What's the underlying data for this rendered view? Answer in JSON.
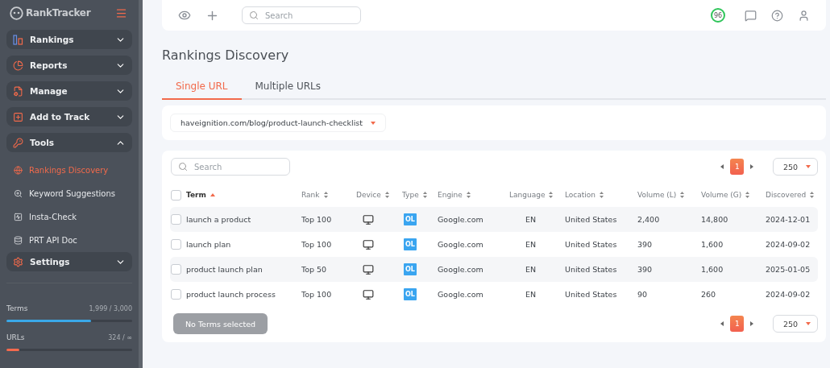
{
  "sidebar": {
    "logo": "RankTracker",
    "menu": [
      {
        "label": "Rankings",
        "kind": "rankings",
        "expanded": false
      },
      {
        "label": "Reports",
        "kind": "reports",
        "expanded": false
      },
      {
        "label": "Manage",
        "kind": "manage",
        "expanded": false
      },
      {
        "label": "Add to Track",
        "kind": "add",
        "expanded": false
      },
      {
        "label": "Tools",
        "kind": "tools",
        "expanded": true,
        "children": [
          {
            "label": "Rankings Discovery",
            "kind": "globe",
            "selected": true
          },
          {
            "label": "Keyword Suggestions",
            "kind": "suggest",
            "selected": false
          },
          {
            "label": "Insta-Check",
            "kind": "insta",
            "selected": false
          },
          {
            "label": "PRT API Doc",
            "kind": "api",
            "selected": false
          }
        ]
      },
      {
        "label": "Settings",
        "kind": "settings",
        "expanded": false
      }
    ],
    "usage": [
      {
        "label": "Terms",
        "reading": "1,999 / 3,000",
        "level": 0.67,
        "color": "#3aa8e8"
      },
      {
        "label": "URLs",
        "reading": "324 / ∞",
        "level": 0.1,
        "color": "#f46a4e"
      }
    ]
  },
  "topbar": {
    "search": {
      "placeholder": "Search"
    },
    "score": "96"
  },
  "page": {
    "title": "Rankings Discovery",
    "tabs": [
      {
        "label": "Single URL",
        "selected": true
      },
      {
        "label": "Multiple URLs",
        "selected": false
      }
    ],
    "url_select": {
      "value": "haveignition.com/blog/product-launch-checklist"
    }
  },
  "table": {
    "search": {
      "placeholder": "Search"
    },
    "pagination_top": {
      "pages": [
        {
          "label": "1",
          "selected": true
        }
      ],
      "per_page": "250"
    },
    "columns": [
      {
        "label": "Term",
        "sorted": true
      },
      {
        "label": "Rank",
        "sorted": false
      },
      {
        "label": "Device",
        "sorted": false
      },
      {
        "label": "Type",
        "sorted": false
      },
      {
        "label": "Engine",
        "sorted": false
      },
      {
        "label": "Language",
        "sorted": false
      },
      {
        "label": "Location",
        "sorted": false
      },
      {
        "label": "Volume (L)",
        "sorted": false
      },
      {
        "label": "Volume (G)",
        "sorted": false
      },
      {
        "label": "Discovered",
        "sorted": false
      }
    ],
    "select_all": {
      "checked": false
    },
    "rows": [
      {
        "checked": false,
        "term": "launch a product",
        "rank": "Top 100",
        "type": "OL",
        "engine": "Google.com",
        "language": "EN",
        "location": "United States",
        "volume_l": "2,400",
        "volume_g": "14,800",
        "discovered": "2024-12-01"
      },
      {
        "checked": false,
        "term": "launch plan",
        "rank": "Top 100",
        "type": "OL",
        "engine": "Google.com",
        "language": "EN",
        "location": "United States",
        "volume_l": "390",
        "volume_g": "1,600",
        "discovered": "2024-09-02"
      },
      {
        "checked": false,
        "term": "product launch plan",
        "rank": "Top 50",
        "type": "OL",
        "engine": "Google.com",
        "language": "EN",
        "location": "United States",
        "volume_l": "390",
        "volume_g": "1,600",
        "discovered": "2025-01-05"
      },
      {
        "checked": false,
        "term": "product launch process",
        "rank": "Top 100",
        "type": "OL",
        "engine": "Google.com",
        "language": "EN",
        "location": "United States",
        "volume_l": "90",
        "volume_g": "260",
        "discovered": "2024-09-02"
      }
    ],
    "action_button": {
      "label": "No Terms selected",
      "disabled": true
    },
    "pagination_bottom": {
      "pages": [
        {
          "label": "1",
          "selected": true
        }
      ],
      "per_page": "250"
    }
  }
}
